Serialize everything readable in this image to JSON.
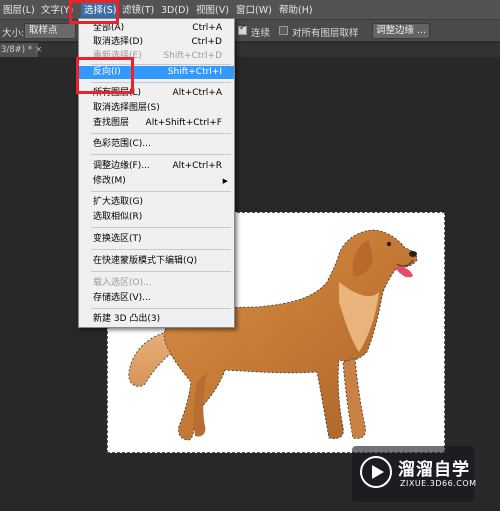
{
  "menubar": {
    "items": [
      {
        "label": "图层(L)"
      },
      {
        "label": "文字(Y)"
      },
      {
        "label": "选择(S)"
      },
      {
        "label": "滤镜(T)"
      },
      {
        "label": "3D(D)"
      },
      {
        "label": "视图(V)"
      },
      {
        "label": "窗口(W)"
      },
      {
        "label": "帮助(H)"
      }
    ]
  },
  "options": {
    "size_label": "大小:",
    "size_value": "取样点",
    "contiguous_label": "连续",
    "all_layers_label": "对所有图层取样",
    "refine_edge_button": "调整边缘 ..."
  },
  "tab": {
    "name": "3/8#) *",
    "close": "×"
  },
  "dropdown": {
    "items": [
      {
        "label": "全部(A)",
        "shortcut": "Ctrl+A",
        "state": "normal"
      },
      {
        "label": "取消选择(D)",
        "shortcut": "Ctrl+D",
        "state": "normal"
      },
      {
        "label": "重新选择(E)",
        "shortcut": "Shift+Ctrl+D",
        "state": "disabled"
      },
      {
        "label": "反向(I)",
        "shortcut": "Shift+Ctrl+I",
        "state": "highlight"
      },
      {
        "label": "所有图层(L)",
        "shortcut": "Alt+Ctrl+A",
        "state": "normal"
      },
      {
        "label": "取消选择图层(S)",
        "shortcut": "",
        "state": "normal"
      },
      {
        "label": "查找图层",
        "shortcut": "Alt+Shift+Ctrl+F",
        "state": "normal"
      },
      {
        "label": "色彩范围(C)...",
        "shortcut": "",
        "state": "normal"
      },
      {
        "label": "调整边缘(F)...",
        "shortcut": "Alt+Ctrl+R",
        "state": "normal"
      },
      {
        "label": "修改(M)",
        "shortcut": "",
        "state": "submenu"
      },
      {
        "label": "扩大选取(G)",
        "shortcut": "",
        "state": "normal"
      },
      {
        "label": "选取相似(R)",
        "shortcut": "",
        "state": "normal"
      },
      {
        "label": "变换选区(T)",
        "shortcut": "",
        "state": "normal"
      },
      {
        "label": "在快速蒙版模式下编辑(Q)",
        "shortcut": "",
        "state": "normal"
      },
      {
        "label": "载入选区(O)...",
        "shortcut": "",
        "state": "disabled"
      },
      {
        "label": "存储选区(V)...",
        "shortcut": "",
        "state": "normal"
      },
      {
        "label": "新建 3D 凸出(3)",
        "shortcut": "",
        "state": "normal"
      }
    ]
  },
  "watermark": {
    "title": "溜溜自学",
    "url": "ZIXUE.3D66.COM"
  },
  "colors": {
    "highlight": "#3399ff",
    "annotation_red": "#e8242a",
    "workspace": "#282828"
  }
}
